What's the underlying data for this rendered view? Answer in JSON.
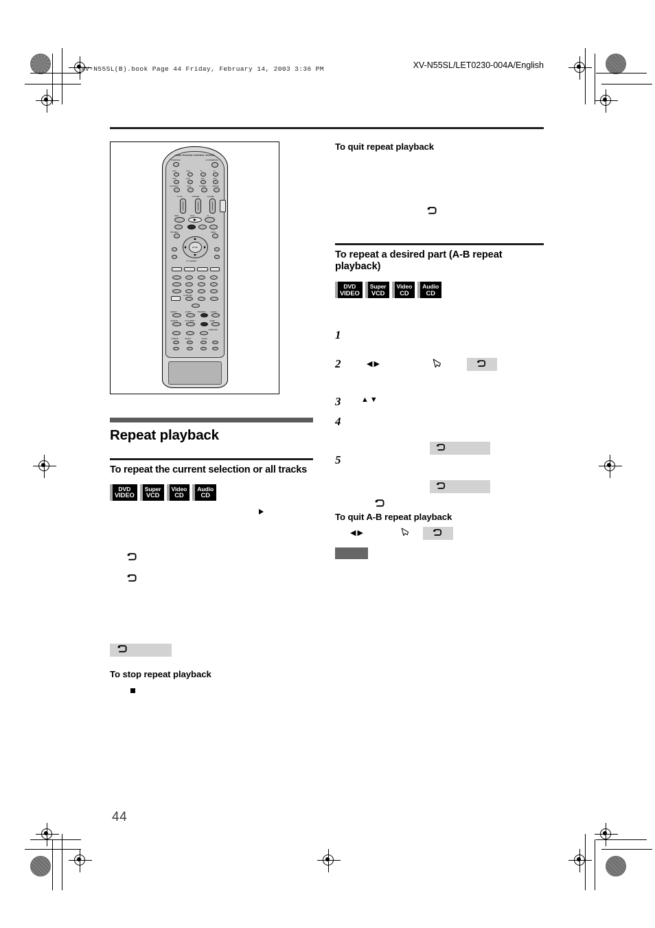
{
  "print_header": {
    "file_line": "XV-N55SL(B).book  Page 44  Friday, February 14, 2003  3:36 PM",
    "document_code": "XV-N55SL/LET0230-004A/English"
  },
  "page_number": "44",
  "remote": {
    "caption": "HOME THEATER CONTROL CENTER",
    "top_labels": {
      "tv_dvd_vcr": "TV/DVD/VCR",
      "av_standby": "AV STANDBY/ON"
    },
    "source_labels": [
      "DVD",
      "DVD",
      "TV",
      "TV",
      "DVD",
      "DVD",
      "VCR",
      "VCR"
    ],
    "mode_labels": [
      "DVD MULTI",
      "TV/AV",
      "TV/VIDEO",
      "MUTING"
    ],
    "slider_labels": [
      "TV VOL",
      "CHANNEL",
      "VOLUME"
    ],
    "transport_labels": [
      "REW",
      "PLAY",
      "FF"
    ],
    "menu_labels": [
      "TOP MENU",
      "MENU",
      "ENTER",
      "PTY SEARCH",
      "DISPLAY"
    ],
    "keypad_rows": [
      [
        "AUDIO",
        "SUBTITLE",
        "TV/VIDEO/ANGLE",
        "RETURN"
      ],
      [
        "ZOOM",
        "1",
        "2",
        "3"
      ],
      [
        "TITLE",
        "4",
        "5",
        "6"
      ],
      [
        "7",
        "8",
        "9",
        "0"
      ],
      [
        "VFP",
        "TV RETURN",
        "10",
        "100"
      ]
    ],
    "bottom_labels": [
      "REPEAT",
      "A-B RPT",
      "PROGRAM",
      "RANDOM",
      "ON SCREEN",
      "SLEEP",
      "SURROUND",
      "CANCEL"
    ]
  },
  "left_column": {
    "section_title": "Repeat playback",
    "subsection_title": "To repeat the current selection or all tracks",
    "media_badges": [
      {
        "line1": "DVD",
        "line2": "VIDEO"
      },
      {
        "line1": "Super",
        "line2": "VCD"
      },
      {
        "line1": "Video",
        "line2": "CD"
      },
      {
        "line1": "Audio",
        "line2": "CD"
      }
    ],
    "inline_icons": {
      "play": "play-triangle-icon",
      "repeat_1": "repeat-icon",
      "repeat_2": "repeat-icon"
    },
    "repeat_key_chip": "repeat-key-icon",
    "stop_title": "To stop repeat playback",
    "stop_icon": "stop-square-icon"
  },
  "right_column": {
    "quit_repeat_title": "To quit repeat playback",
    "quit_repeat_icon": "repeat-icon",
    "ab_section_title": "To repeat a desired part (A-B repeat playback)",
    "media_badges": [
      {
        "line1": "DVD",
        "line2": "VIDEO"
      },
      {
        "line1": "Super",
        "line2": "VCD"
      },
      {
        "line1": "Video",
        "line2": "CD"
      },
      {
        "line1": "Audio",
        "line2": "CD"
      }
    ],
    "steps": [
      {
        "number": "1"
      },
      {
        "number": "2",
        "arrows": "◀▶",
        "cursor": "cursor-pointer-icon",
        "chip": "repeat-key-icon"
      },
      {
        "number": "3",
        "arrows": "▲▼"
      },
      {
        "number": "4",
        "chip": "repeat-key-icon"
      },
      {
        "number": "5",
        "chip": "repeat-key-icon"
      }
    ],
    "trailing_repeat_icon": "repeat-icon",
    "quit_ab_title": "To quit A-B repeat playback",
    "quit_ab_arrows": "◀▶",
    "quit_ab_cursor": "cursor-pointer-icon",
    "quit_ab_chip": "repeat-key-icon",
    "note_bar": "note-bar"
  }
}
